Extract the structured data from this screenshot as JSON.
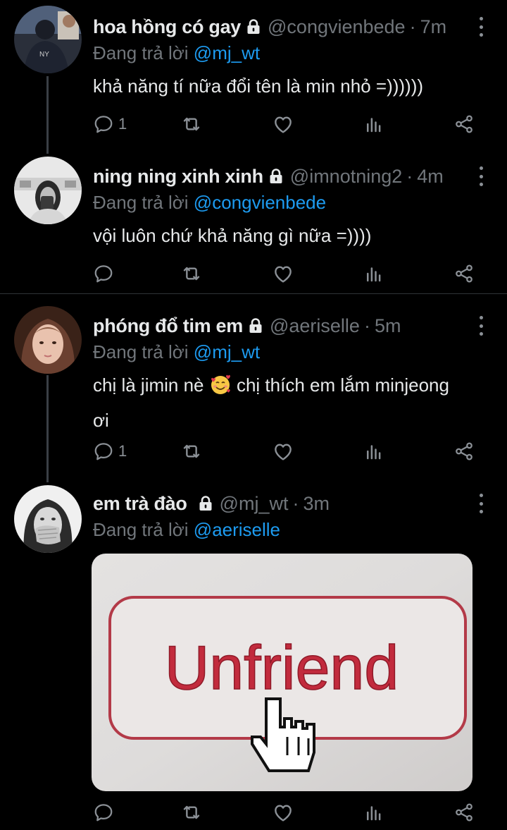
{
  "tweets": [
    {
      "name": "hoa hồng có gay",
      "handle": "@congvienbede",
      "time": "7m",
      "reply_prefix": "Đang trả lời",
      "reply_to": "@mj_wt",
      "text": "khả năng tí nữa đổi tên là min nhỏ =))))))",
      "reply_count": "1"
    },
    {
      "name": "ning ning xinh xinh",
      "handle": "@imnotning2",
      "time": "4m",
      "reply_prefix": "Đang trả lời",
      "reply_to": "@congvienbede",
      "text": "vội luôn chứ khả năng gì nữa =))))",
      "reply_count": ""
    },
    {
      "name": "phóng đổ tim em",
      "handle": "@aeriselle",
      "time": "5m",
      "reply_prefix": "Đang trả lời",
      "reply_to": "@mj_wt",
      "text_before_emoji": "chị là jimin nè ",
      "text_after_emoji": " chị thích em lắm minjeong",
      "text_line2": "ơi",
      "reply_count": "1"
    },
    {
      "name": "em trà đào",
      "handle": "@mj_wt",
      "time": "3m",
      "reply_prefix": "Đang trả lời",
      "reply_to": "@aeriselle",
      "media_text": "Unfriend",
      "reply_count": ""
    }
  ],
  "separator": "·",
  "icons": {
    "lock": "lock-icon",
    "more": "more-vertical-icon",
    "reply": "reply-icon",
    "retweet": "retweet-icon",
    "like": "heart-icon",
    "analytics": "analytics-icon",
    "share": "share-icon",
    "emoji": "smiling-face-with-hearts-emoji"
  },
  "colors": {
    "background": "#000000",
    "text": "#e7e9ea",
    "muted": "#71767b",
    "link": "#1d9bf0",
    "divider": "#2f3336"
  }
}
